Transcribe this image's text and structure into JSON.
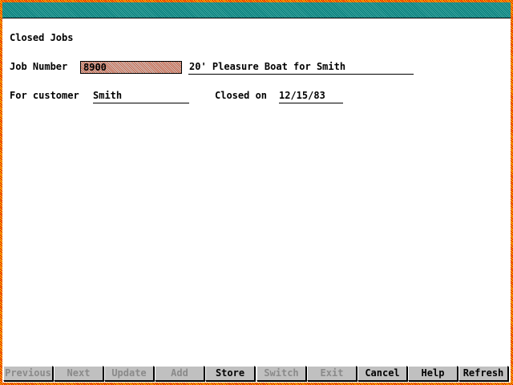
{
  "form": {
    "heading": "Closed Jobs",
    "job_number_label": "Job Number",
    "job_number_value": "8900",
    "job_description": "20' Pleasure Boat for Smith",
    "customer_label": "For customer",
    "customer_value": "Smith",
    "closed_label": "Closed on",
    "closed_value": "12/15/83"
  },
  "buttons": [
    {
      "label": "Previous",
      "enabled": false
    },
    {
      "label": "Next",
      "enabled": false
    },
    {
      "label": "Update",
      "enabled": false
    },
    {
      "label": "Add",
      "enabled": false
    },
    {
      "label": "Store",
      "enabled": true
    },
    {
      "label": "Switch",
      "enabled": false
    },
    {
      "label": "Exit",
      "enabled": false
    },
    {
      "label": "Cancel",
      "enabled": true
    },
    {
      "label": "Help",
      "enabled": true
    },
    {
      "label": "Refresh",
      "enabled": true
    }
  ],
  "colors": {
    "titlebar": "#007878",
    "border": "#e00000",
    "field_highlight": "#d06040"
  }
}
